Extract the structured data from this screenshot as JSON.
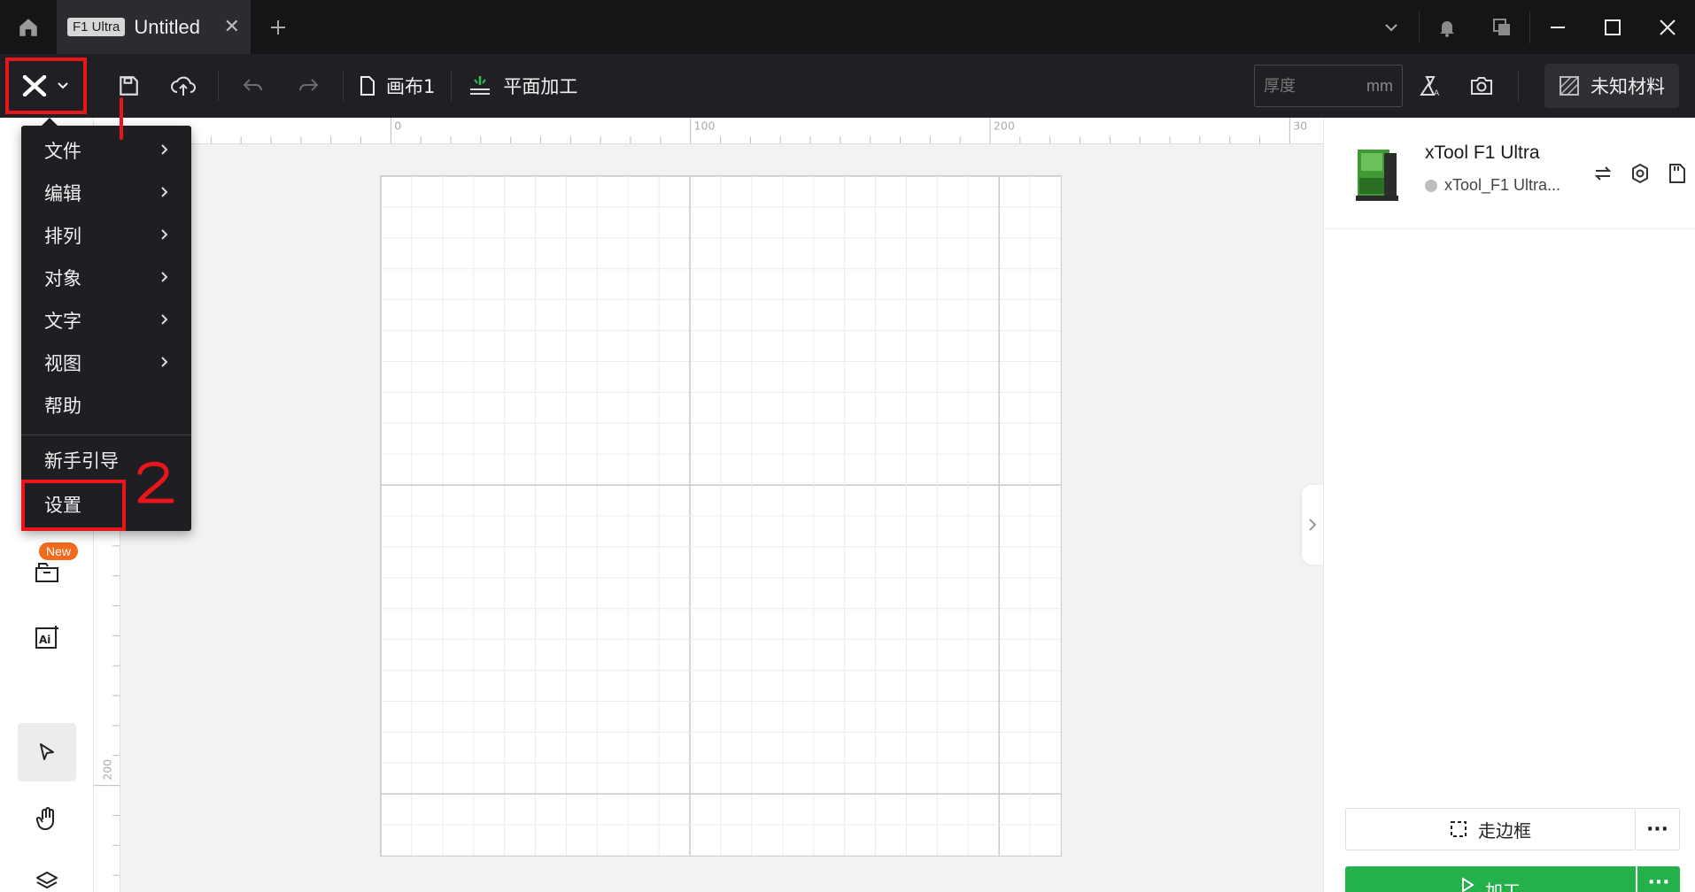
{
  "titlebar": {
    "tab_badge": "F1 Ultra",
    "tab_title": "Untitled",
    "add_tab": "+"
  },
  "toolbar": {
    "canvas_label": "画布1",
    "mode_label": "平面加工",
    "thickness_placeholder": "厚度",
    "thickness_value": "",
    "thickness_unit": "mm",
    "material_label": "未知材料"
  },
  "menu": {
    "items": [
      {
        "label": "文件",
        "submenu": true
      },
      {
        "label": "编辑",
        "submenu": true
      },
      {
        "label": "排列",
        "submenu": true
      },
      {
        "label": "对象",
        "submenu": true
      },
      {
        "label": "文字",
        "submenu": true
      },
      {
        "label": "视图",
        "submenu": true
      },
      {
        "label": "帮助",
        "submenu": false
      }
    ],
    "extra": [
      {
        "label": "新手引导"
      },
      {
        "label": "设置"
      }
    ]
  },
  "annotations": {
    "step1": "1",
    "step2": "2"
  },
  "sidebar": {
    "new_badge": "New"
  },
  "ruler": {
    "top_ticks": [
      "0",
      "100",
      "200",
      "30"
    ],
    "left_ticks": [
      "200"
    ]
  },
  "device": {
    "name": "xTool F1 Ultra",
    "status": "xTool_F1 Ultra..."
  },
  "actions": {
    "frame_label": "走边框",
    "process_label": "加工",
    "more_label": "···"
  },
  "colors": {
    "annotation_red": "#e8161a",
    "process_green": "#24b04b",
    "new_badge_orange": "#f26a1b"
  }
}
